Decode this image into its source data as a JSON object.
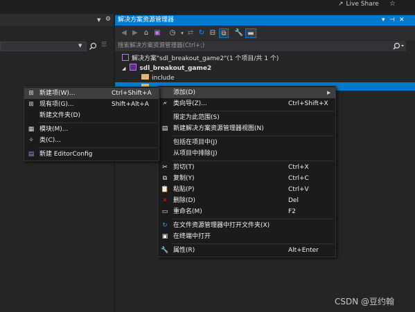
{
  "top": {
    "live_share": "Live Share"
  },
  "solution_explorer": {
    "title": "解决方案资源管理器",
    "title_controls": [
      "▾",
      "⊣",
      "✕"
    ],
    "search_placeholder": "搜索解决方案资源管理器(Ctrl+;)",
    "tree": {
      "solution": "解决方案\"sdl_breakout_game2\"(1 个项目/共 1 个)",
      "project": "sdl_breakout_game2",
      "folder": "include"
    }
  },
  "context_menu": {
    "items": [
      {
        "label": "添加(D)",
        "shortcut": "",
        "icon": ""
      },
      {
        "label": "类向导(Z)...",
        "shortcut": "Ctrl+Shift+X",
        "icon": "class-wizard-icon"
      },
      {
        "label": "限定为此范围(S)",
        "shortcut": "",
        "icon": ""
      },
      {
        "label": "新建解决方案资源管理器视图(N)",
        "shortcut": "",
        "icon": "new-view-icon"
      },
      {
        "label": "包括在项目中(J)",
        "shortcut": "",
        "icon": ""
      },
      {
        "label": "从项目中排除(J)",
        "shortcut": "",
        "icon": ""
      },
      {
        "label": "剪切(T)",
        "shortcut": "Ctrl+X",
        "icon": "cut-icon"
      },
      {
        "label": "复制(Y)",
        "shortcut": "Ctrl+C",
        "icon": "copy-icon"
      },
      {
        "label": "粘贴(P)",
        "shortcut": "Ctrl+V",
        "icon": "paste-icon"
      },
      {
        "label": "删除(D)",
        "shortcut": "Del",
        "icon": "delete-icon"
      },
      {
        "label": "重命名(M)",
        "shortcut": "F2",
        "icon": "rename-icon"
      },
      {
        "label": "在文件资源管理器中打开文件夹(X)",
        "shortcut": "",
        "icon": "open-folder-icon"
      },
      {
        "label": "在终端中打开",
        "shortcut": "",
        "icon": "terminal-icon"
      },
      {
        "label": "属性(R)",
        "shortcut": "Alt+Enter",
        "icon": "properties-icon"
      }
    ]
  },
  "submenu": {
    "items": [
      {
        "label": "新建项(W)...",
        "shortcut": "Ctrl+Shift+A",
        "icon": "new-item-icon"
      },
      {
        "label": "现有项(G)...",
        "shortcut": "Shift+Alt+A",
        "icon": "existing-item-icon"
      },
      {
        "label": "新建文件夹(D)",
        "shortcut": "",
        "icon": ""
      },
      {
        "label": "模块(M)...",
        "shortcut": "",
        "icon": "module-icon"
      },
      {
        "label": "类(C)...",
        "shortcut": "",
        "icon": "class-icon"
      },
      {
        "label": "新建 EditorConfig",
        "shortcut": "",
        "icon": "editorconfig-icon"
      }
    ]
  },
  "watermark": "CSDN @豆约翰",
  "colors": {
    "accent": "#007acc",
    "menu_bg": "#1b1b1c",
    "highlight": "#3e3e40"
  }
}
